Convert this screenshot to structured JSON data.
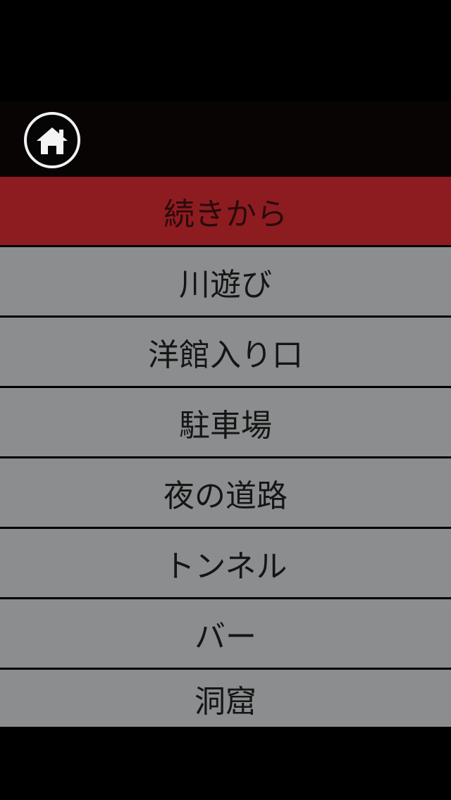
{
  "header": {
    "home_icon": "home-icon"
  },
  "colors": {
    "active_item": "#8d1c20",
    "item": "#8b8d8e",
    "header": "#080404",
    "background": "#000000"
  },
  "menu": {
    "items": [
      {
        "label": "続きから"
      },
      {
        "label": "川遊び"
      },
      {
        "label": "洋館入り口"
      },
      {
        "label": "駐車場"
      },
      {
        "label": "夜の道路"
      },
      {
        "label": "トンネル"
      },
      {
        "label": "バー"
      },
      {
        "label": "洞窟"
      }
    ]
  }
}
